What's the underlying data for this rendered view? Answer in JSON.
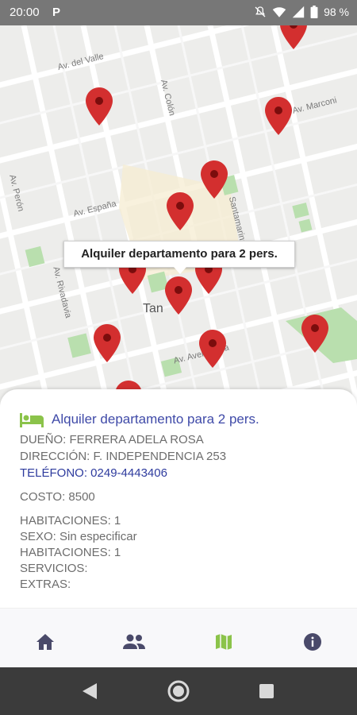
{
  "status_bar": {
    "time": "20:00",
    "p_icon": "P",
    "icons": [
      "mute-icon",
      "wifi-icon",
      "signal-icon",
      "battery-icon"
    ],
    "battery": "98 %"
  },
  "map": {
    "streets": [
      "Av. del Valle",
      "Av. Colón",
      "Av. Marconi",
      "Av. Perón",
      "Av. España",
      "Santamarina",
      "Av. Rivadavia",
      "Av. Avellaneda"
    ],
    "town_label": "Tan",
    "tooltip": "Alquiler departamento para 2 pers.",
    "pin_color": "#d32f2f"
  },
  "card": {
    "icon": "bed-icon",
    "icon_color": "#8bc34a",
    "title": "Alquiler departamento para 2 pers.",
    "owner": "DUEÑO:  FERRERA ADELA ROSA",
    "address": "DIRECCIÓN: F. INDEPENDENCIA 253",
    "phone": "TELÉFONO: 0249-4443406",
    "cost": "COSTO: 8500",
    "rooms": "HABITACIONES: 1",
    "sex": "SEXO: Sin especificar",
    "rooms2": "HABITACIONES: 1",
    "services": "SERVICIOS:",
    "extras": "EXTRAS:"
  },
  "bottom_nav": {
    "items": [
      "home-icon",
      "people-icon",
      "map-icon",
      "info-icon"
    ],
    "active": "map-icon",
    "active_color": "#8bc34a",
    "inactive_color": "#4a4a6a"
  },
  "system_nav": [
    "back-icon",
    "home-circle-icon",
    "recents-icon"
  ]
}
